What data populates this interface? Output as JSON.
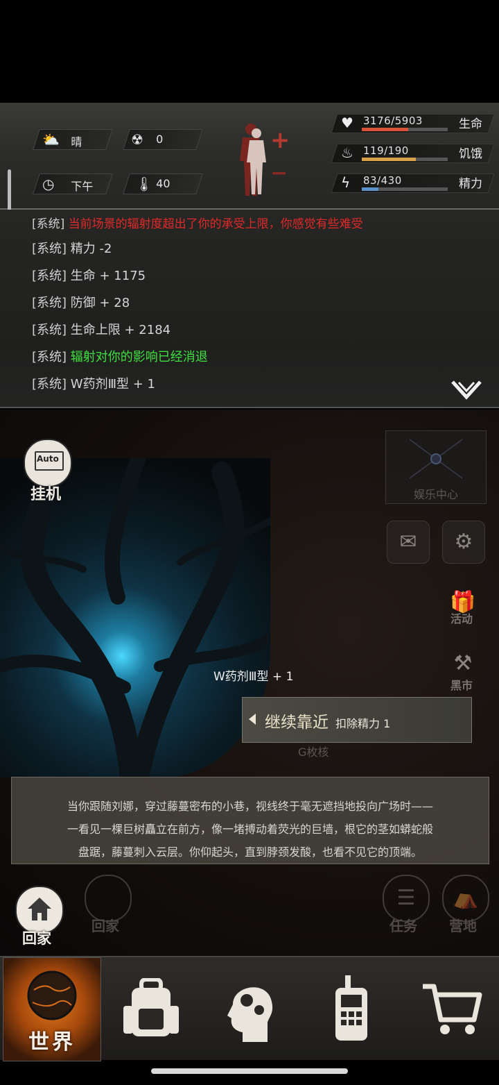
{
  "environment": {
    "weather": {
      "icon": "partly-cloudy-icon",
      "label": "晴"
    },
    "radiation": {
      "icon": "radiation-icon",
      "value": "0"
    },
    "time": {
      "icon": "clock-icon",
      "label": "下午"
    },
    "temperature": {
      "icon": "thermometer-icon",
      "value": "40"
    }
  },
  "body_status": {
    "plus": "+",
    "minus": "−"
  },
  "stats": {
    "health": {
      "label": "生命",
      "value": "3176/5903",
      "fraction": 0.538,
      "color": "#d9533a",
      "icon": "heart-pulse-icon"
    },
    "hunger": {
      "label": "饥饿",
      "value": "119/190",
      "fraction": 0.626,
      "color": "#d7a24a",
      "icon": "stomach-icon"
    },
    "energy": {
      "label": "精力",
      "value": "83/430",
      "fraction": 0.193,
      "color": "#5b92c9",
      "icon": "energy-bolt-icon"
    }
  },
  "log": {
    "lines": [
      {
        "tag": "[系统]",
        "text": "当前场景的辐射度超出了你的承受上限，你感觉有些难受",
        "color": "#e02a2a"
      },
      {
        "tag": "[系统]",
        "text": "精力 -2",
        "color": "#d6d6d6"
      },
      {
        "tag": "[系统]",
        "text": "生命 + 1175",
        "color": "#d6d6d6"
      },
      {
        "tag": "[系统]",
        "text": "防御 + 28",
        "color": "#d6d6d6"
      },
      {
        "tag": "[系统]",
        "text": "生命上限 + 2184",
        "color": "#d6d6d6"
      },
      {
        "tag": "[系统]",
        "text": "辐射对你的影响已经消退",
        "color": "#3fe03f"
      },
      {
        "tag": "[系统]",
        "text": "W药剂Ⅲ型 + 1",
        "color": "#d6d6d6"
      }
    ]
  },
  "scene": {
    "auto": {
      "badge": "Auto",
      "label": "挂机"
    },
    "entertainment_center": "娱乐中心",
    "activity": "活动",
    "black_market": "黑市",
    "loot_popup": "W药剂Ⅲ型 + 1",
    "approach": {
      "label": "继续靠近",
      "cost": "扣除精力 1"
    },
    "sign_text": "G枚核",
    "story": [
      "当你跟随刘娜，穿过藤蔓密布的小巷，视线终于毫无遮挡地投向广场时——",
      "一看见一棵巨树矗立在前方，像一堵搏动着荧光的巨墙，根它的茎如蟒蛇般",
      "盘踞，藤蔓刺入云层。你仰起头，直到脖颈发酸，也看不见它的顶端。"
    ],
    "home_buttons": [
      "回家",
      "回家"
    ],
    "task": "任务",
    "camp": "营地"
  },
  "bottom_nav": [
    {
      "label": "世界",
      "icon": "globe-icon"
    },
    {
      "label": "",
      "icon": "backpack-icon"
    },
    {
      "label": "",
      "icon": "skills-head-icon"
    },
    {
      "label": "",
      "icon": "walkie-talkie-icon"
    },
    {
      "label": "",
      "icon": "shopping-cart-icon"
    }
  ]
}
